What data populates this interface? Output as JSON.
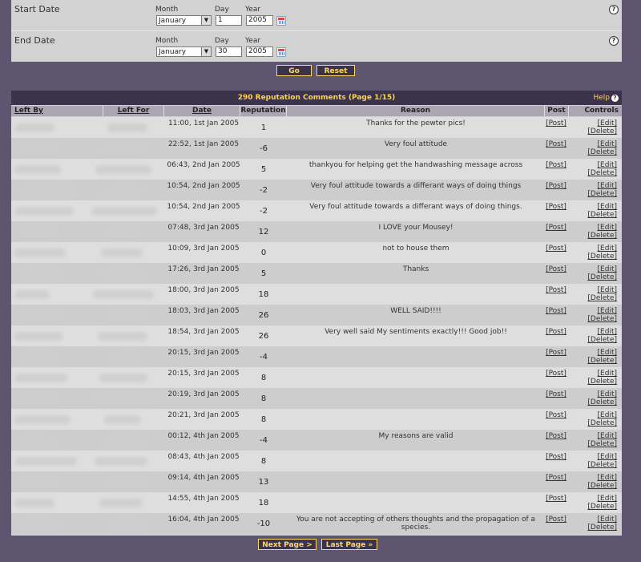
{
  "filter": {
    "start": {
      "label": "Start Date",
      "month_label": "Month",
      "day_label": "Day",
      "year_label": "Year",
      "month": "January",
      "day": "1",
      "year": "2005"
    },
    "end": {
      "label": "End Date",
      "month_label": "Month",
      "day_label": "Day",
      "year_label": "Year",
      "month": "January",
      "day": "30",
      "year": "2005"
    },
    "go_label": "Go",
    "reset_label": "Reset",
    "help_glyph": "?"
  },
  "results": {
    "title": "290 Reputation Comments (Page 1/15)",
    "help_label": "Help",
    "help_glyph": "?",
    "columns": [
      "Left By",
      "Left For",
      "Date",
      "Reputation",
      "Reason",
      "Post",
      "Controls"
    ],
    "rows": [
      {
        "date": "11:00, 1st Jan 2005",
        "rep": "1",
        "reason": "Thanks for the pewter pics!"
      },
      {
        "date": "22:52, 1st Jan 2005",
        "rep": "-6",
        "reason": "Very foul attitude"
      },
      {
        "date": "06:43, 2nd Jan 2005",
        "rep": "5",
        "reason": "thankyou for helping get the handwashing message across"
      },
      {
        "date": "10:54, 2nd Jan 2005",
        "rep": "-2",
        "reason": "Very foul attitude towards a differant ways of doing things"
      },
      {
        "date": "10:54, 2nd Jan 2005",
        "rep": "-2",
        "reason": "Very foul attitude towards a differant ways of doing things."
      },
      {
        "date": "07:48, 3rd Jan 2005",
        "rep": "12",
        "reason": "I LOVE your Mousey!"
      },
      {
        "date": "10:09, 3rd Jan 2005",
        "rep": "0",
        "reason": "not to house them"
      },
      {
        "date": "17:26, 3rd Jan 2005",
        "rep": "5",
        "reason": "Thanks"
      },
      {
        "date": "18:00, 3rd Jan 2005",
        "rep": "18",
        "reason": ""
      },
      {
        "date": "18:03, 3rd Jan 2005",
        "rep": "26",
        "reason": "WELL SAID!!!!"
      },
      {
        "date": "18:54, 3rd Jan 2005",
        "rep": "26",
        "reason": "Very well said        My sentiments exactly!!! Good job!!"
      },
      {
        "date": "20:15, 3rd Jan 2005",
        "rep": "-4",
        "reason": ""
      },
      {
        "date": "20:15, 3rd Jan 2005",
        "rep": "8",
        "reason": ""
      },
      {
        "date": "20:19, 3rd Jan 2005",
        "rep": "8",
        "reason": ""
      },
      {
        "date": "20:21, 3rd Jan 2005",
        "rep": "8",
        "reason": ""
      },
      {
        "date": "00:12, 4th Jan 2005",
        "rep": "-4",
        "reason": "My reasons are valid"
      },
      {
        "date": "08:43, 4th Jan 2005",
        "rep": "8",
        "reason": ""
      },
      {
        "date": "09:14, 4th Jan 2005",
        "rep": "13",
        "reason": ""
      },
      {
        "date": "14:55, 4th Jan 2005",
        "rep": "18",
        "reason": ""
      },
      {
        "date": "16:04, 4th Jan 2005",
        "rep": "-10",
        "reason": "You are not accepting of others thoughts and the propagation of a species."
      }
    ],
    "post_label": "[Post]",
    "edit_label": "[Edit]",
    "delete_label": "[Delete]",
    "next_label": "Next Page >",
    "last_label": "Last Page »"
  }
}
